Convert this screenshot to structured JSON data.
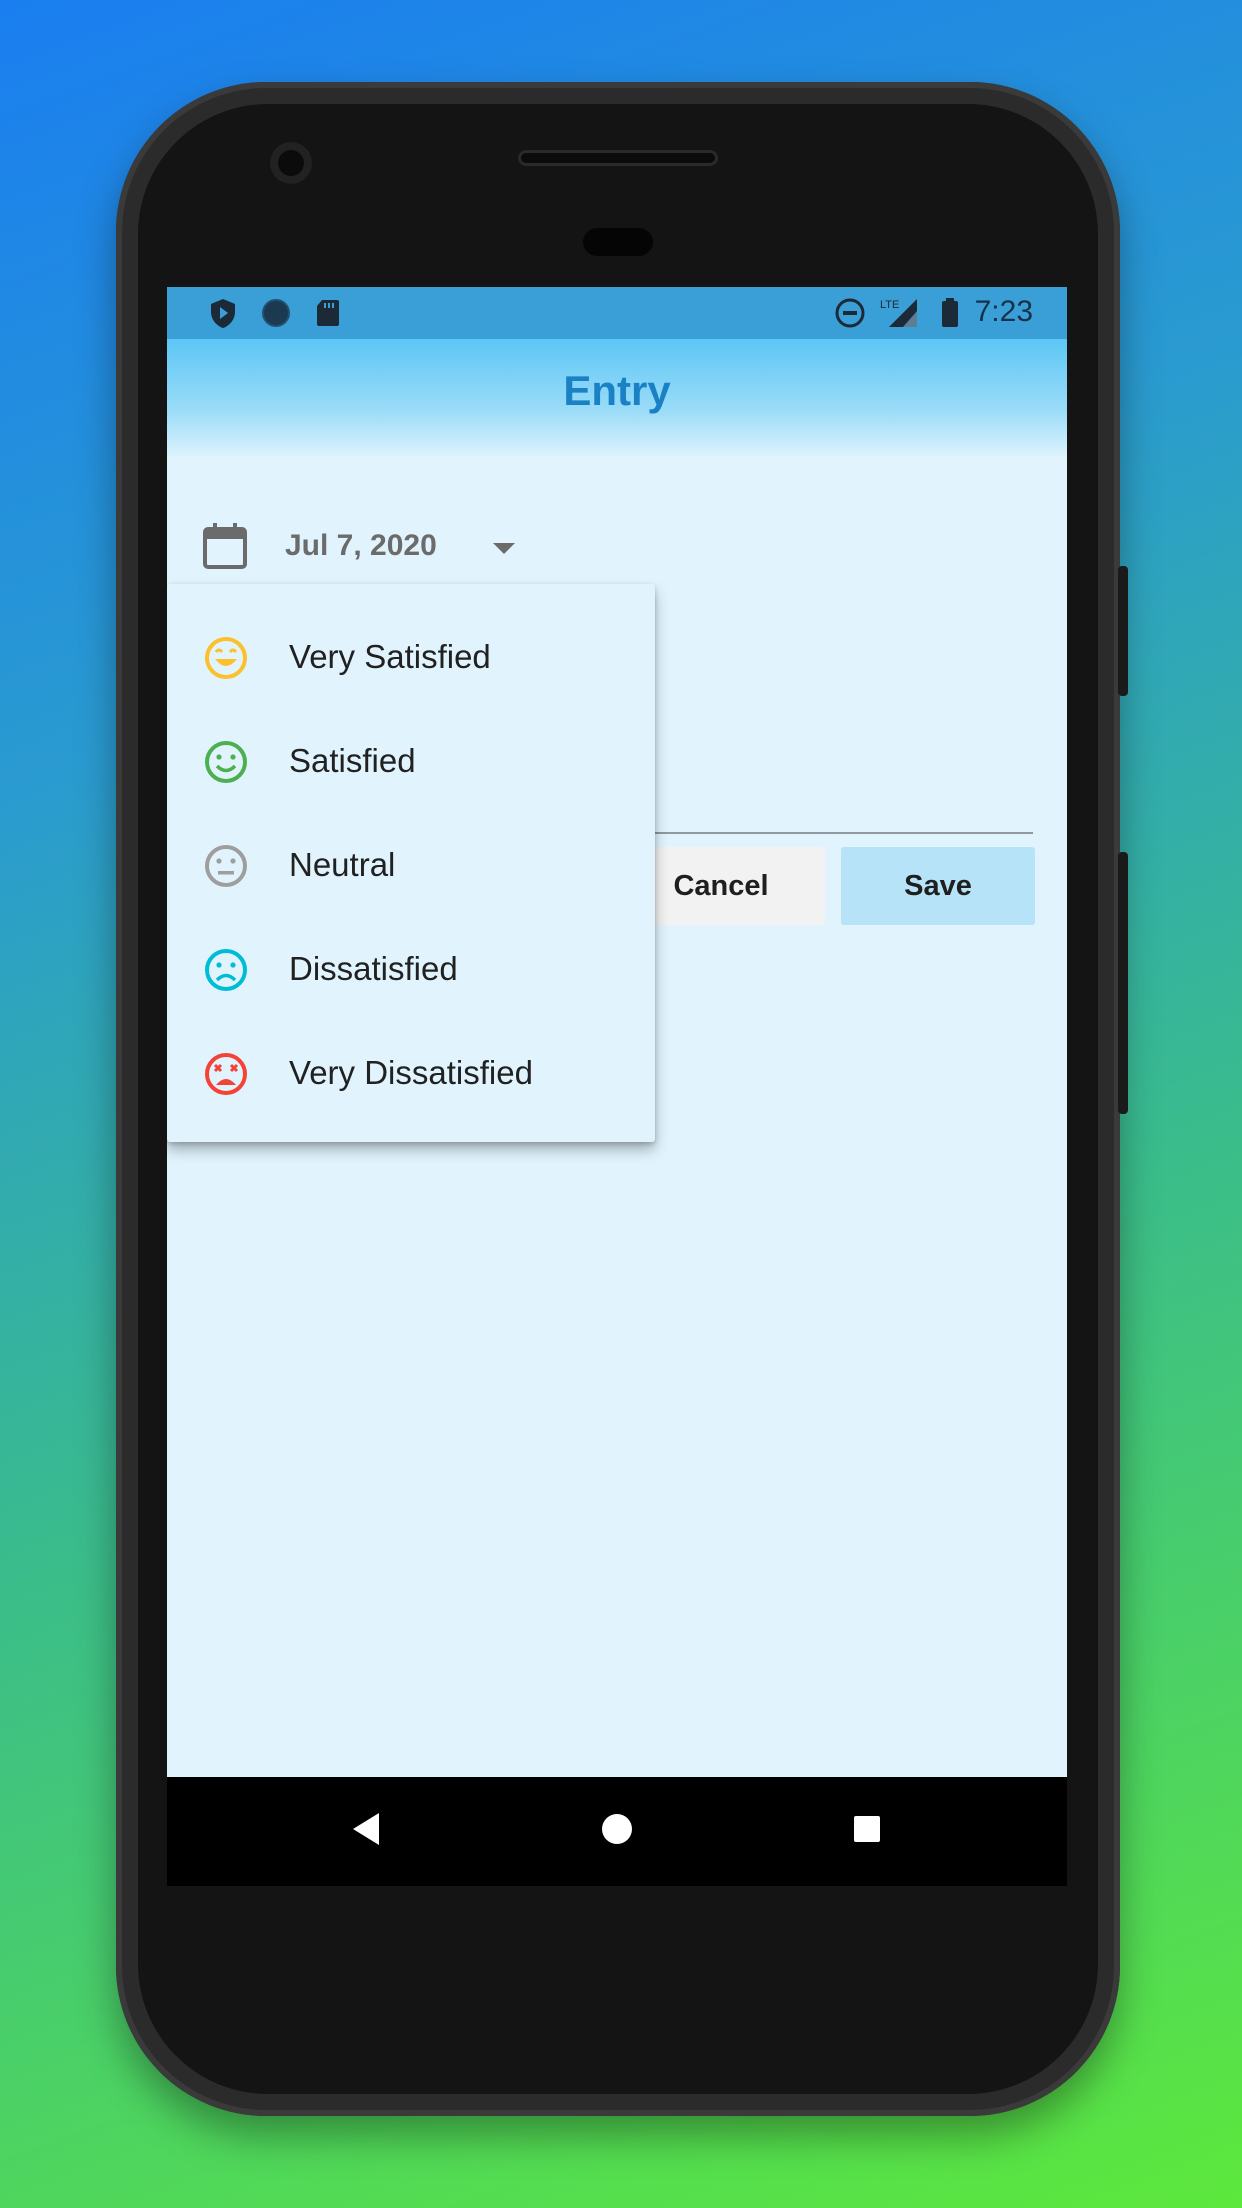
{
  "status_bar": {
    "time": "7:23",
    "left_icons": [
      "play-protect-icon",
      "sync-circle-icon",
      "sd-card-icon"
    ],
    "right_icons": [
      "do-not-disturb-icon",
      "lte-signal-icon",
      "battery-icon"
    ],
    "network_label": "LTE"
  },
  "app_bar": {
    "title": "Entry"
  },
  "date_picker": {
    "value": "Jul 7, 2020",
    "icon": "calendar-icon"
  },
  "mood_menu": {
    "items": [
      {
        "label": "Very Satisfied",
        "icon": "very-satisfied-icon",
        "color": "#fbc02d"
      },
      {
        "label": "Satisfied",
        "icon": "satisfied-icon",
        "color": "#4caf50"
      },
      {
        "label": "Neutral",
        "icon": "neutral-icon",
        "color": "#9e9e9e"
      },
      {
        "label": "Dissatisfied",
        "icon": "dissatisfied-icon",
        "color": "#00bcd4"
      },
      {
        "label": "Very Dissatisfied",
        "icon": "very-dissatisfied-icon",
        "color": "#f44336"
      }
    ]
  },
  "actions": {
    "cancel_label": "Cancel",
    "save_label": "Save"
  },
  "nav_bar": {
    "icons": [
      "back-icon",
      "home-icon",
      "recents-icon"
    ]
  },
  "colors": {
    "accent": "#1a82c4",
    "screen_bg": "#e1f4fd",
    "save_bg": "#b6e3f8"
  }
}
